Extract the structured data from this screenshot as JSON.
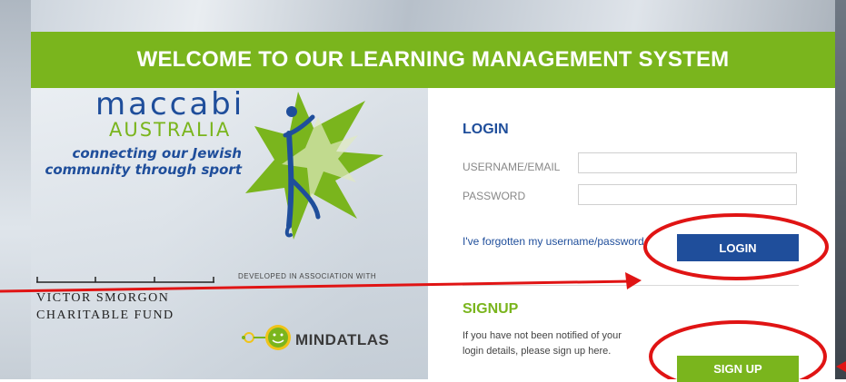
{
  "banner": {
    "title": "WELCOME TO OUR LEARNING MANAGEMENT SYSTEM"
  },
  "branding": {
    "maccabi": "maccabi",
    "australia": "AUSTRALIA",
    "tagline_line1": "connecting our Jewish",
    "tagline_line2": "community through sport",
    "victor_line1": "VICTOR SMORGON",
    "victor_line2": "CHARITABLE FUND",
    "developed": "DEVELOPED IN ASSOCIATION WITH",
    "mindatlas": "MINDATLAS"
  },
  "login": {
    "heading": "LOGIN",
    "username_label": "USERNAME/EMAIL",
    "username_value": "",
    "password_label": "PASSWORD",
    "password_value": "",
    "forgot_link": "I've forgotten my username/password",
    "button": "LOGIN"
  },
  "signup": {
    "heading": "SIGNUP",
    "text_line1": "If you have not been notified of your",
    "text_line2": "login details, please sign up here.",
    "button": "SIGN UP"
  },
  "colors": {
    "green": "#7ab51d",
    "blue": "#1f4e9b",
    "annotation_red": "#e01414"
  },
  "icons": [
    "maccabi-star-logo-icon",
    "mindatlas-logo-icon"
  ]
}
